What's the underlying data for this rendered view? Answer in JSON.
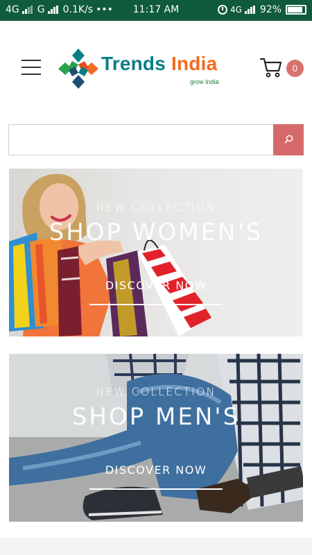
{
  "status_bar": {
    "net1": "4G",
    "net2": "G",
    "speed": "0.1K/s",
    "dots": "•••",
    "time": "11:17 AM",
    "net3": "4G",
    "battery": "92%"
  },
  "header": {
    "logo_word1": "Trends",
    "logo_word2": "India",
    "logo_tagline": "grow India",
    "cart_count": "0"
  },
  "search": {
    "placeholder": "",
    "value": ""
  },
  "banners": [
    {
      "kicker": "NEW COLLECTION",
      "title": "SHOP WOMEN'S",
      "cta": "DISCOVER NOW"
    },
    {
      "kicker": "NEW COLLECTION",
      "title": "SHOP MEN'S",
      "cta": "DISCOVER NOW"
    }
  ],
  "colors": {
    "status_bar": "#0f5b3b",
    "accent": "#d66a6a",
    "brand_teal": "#0c7e86",
    "brand_orange": "#f26a21"
  }
}
